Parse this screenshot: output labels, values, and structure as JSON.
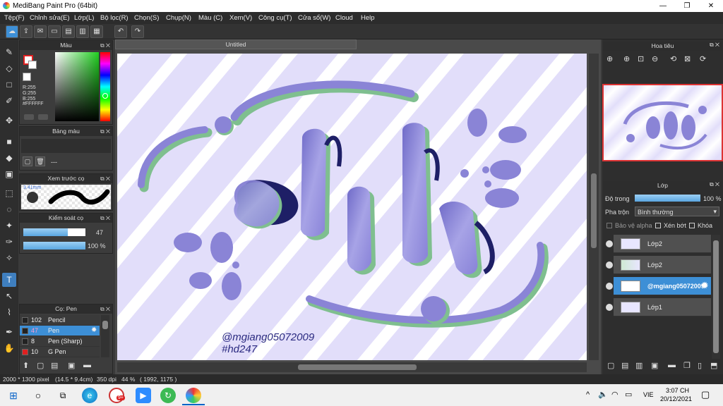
{
  "window": {
    "title": "MediBang Paint Pro (64bit)",
    "minimize": "—",
    "maximize": "❐",
    "close": "✕"
  },
  "menu": [
    "Tệp(F)",
    "Chỉnh sửa(E)",
    "Lớp(L)",
    "Bộ lọc(R)",
    "Chọn(S)",
    "Chụp(N)",
    "Màu (C)",
    "Xem(V)",
    "Công cụ(T)",
    "Cửa sổ(W)",
    "Cloud",
    "Help"
  ],
  "document_tab": "Untitled",
  "color_panel": {
    "title": "Màu",
    "r": "R:255",
    "g": "G:255",
    "b": "B:255",
    "hex": "#FFFFFF"
  },
  "palette_panel": {
    "title": "Bảng màu",
    "empty": "---"
  },
  "brush_preview_panel": {
    "title": "Xem trước cọ",
    "size": "3.41mm"
  },
  "brush_control_panel": {
    "title": "Kiểm soát cọ",
    "size_value": "47",
    "opacity_value": "100 %",
    "size_fraction": 0.72,
    "opacity_fraction": 1.0
  },
  "brush_list_panel": {
    "title": "Cọ: Pen",
    "brushes": [
      {
        "size": "102",
        "name": "Pencil",
        "color": "#222222"
      },
      {
        "size": "47",
        "name": "Pen",
        "color": "#222222"
      },
      {
        "size": "8",
        "name": "Pen (Sharp)",
        "color": "#222222"
      },
      {
        "size": "10",
        "name": "G Pen",
        "color": "#e02020"
      }
    ],
    "selected_index": 1
  },
  "navigator_panel": {
    "title": "Hoa tiêu"
  },
  "layer_panel": {
    "title": "Lớp",
    "opacity_label": "Độ trong",
    "opacity_value": "100 %",
    "opacity_fraction": 1.0,
    "blend_label": "Pha trộn",
    "blend_value": "Bình thường",
    "protect_alpha": "Bảo vệ alpha",
    "clipping": "Xén bớt",
    "lock": "Khóa",
    "layers": [
      {
        "name": "Lớp2"
      },
      {
        "name": "Lớp2"
      },
      {
        "name": "@mgiang05072009"
      },
      {
        "name": "Lớp1"
      }
    ],
    "selected_index": 2
  },
  "artwork": {
    "signature": "@mgiang05072009",
    "hashtag": "#hd247",
    "colors": {
      "background": "#e2defa",
      "stripe": "#ffffff",
      "letter": "#8a84d6",
      "shadow": "#7fbf8f",
      "outline": "#1e1f66"
    }
  },
  "status": {
    "pixels": "2000 * 1300 pixel",
    "size": "(14.5 * 9.4cm)",
    "dpi": "350 dpi",
    "zoom": "44 %",
    "cursor": "( 1992, 1175 )"
  },
  "taskbar": {
    "lang": "VIE",
    "time": "3:07 CH",
    "date": "20/12/2021",
    "badge": "9+"
  }
}
